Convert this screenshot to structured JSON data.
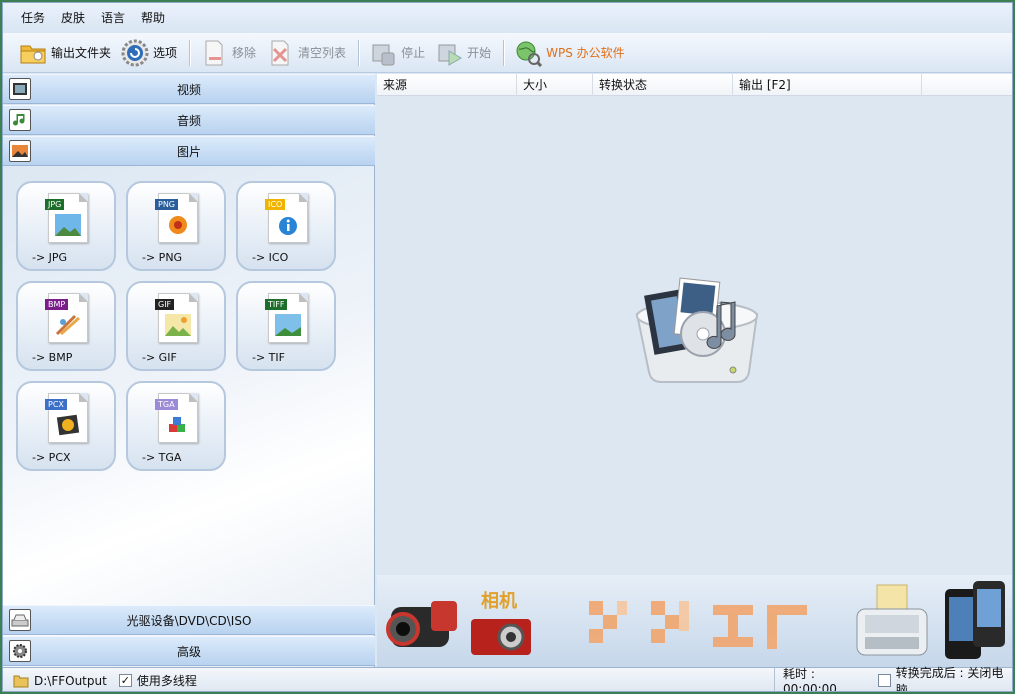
{
  "menu": [
    "任务",
    "皮肤",
    "语言",
    "帮助"
  ],
  "toolbar": {
    "output_folder": "输出文件夹",
    "options": "选项",
    "remove": "移除",
    "clear_list": "清空列表",
    "stop": "停止",
    "start": "开始",
    "wps": "WPS 办公软件"
  },
  "categories": {
    "video": "视频",
    "audio": "音频",
    "picture": "图片",
    "rom": "光驱设备\\DVD\\CD\\ISO",
    "advanced": "高级"
  },
  "formats": [
    {
      "tag": "JPG",
      "label": "-> JPG",
      "tag_color": "#1d6e2a"
    },
    {
      "tag": "PNG",
      "label": "-> PNG",
      "tag_color": "#2a5e9a"
    },
    {
      "tag": "ICO",
      "label": "-> ICO",
      "tag_color": "#f0b400"
    },
    {
      "tag": "BMP",
      "label": "-> BMP",
      "tag_color": "#7a1f8a"
    },
    {
      "tag": "GIF",
      "label": "-> GIF",
      "tag_color": "#222222"
    },
    {
      "tag": "TIFF",
      "label": "-> TIF",
      "tag_color": "#1d6e2a"
    },
    {
      "tag": "PCX",
      "label": "-> PCX",
      "tag_color": "#3b6fc8"
    },
    {
      "tag": "TGA",
      "label": "-> TGA",
      "tag_color": "#9b8ad6"
    }
  ],
  "list_columns": [
    "来源",
    "大小",
    "转换状态",
    "输出 [F2]"
  ],
  "banner": {
    "camera_text": "相机"
  },
  "status": {
    "output_path": "D:\\FFOutput",
    "multithread": "使用多线程",
    "elapsed": "耗时 : 00:00:00",
    "after_convert": "转换完成后 : 关闭电脑"
  },
  "colors": {
    "accent": "#3a78c6",
    "wps": "#e0701a",
    "window_bg": "#dde7f3"
  }
}
